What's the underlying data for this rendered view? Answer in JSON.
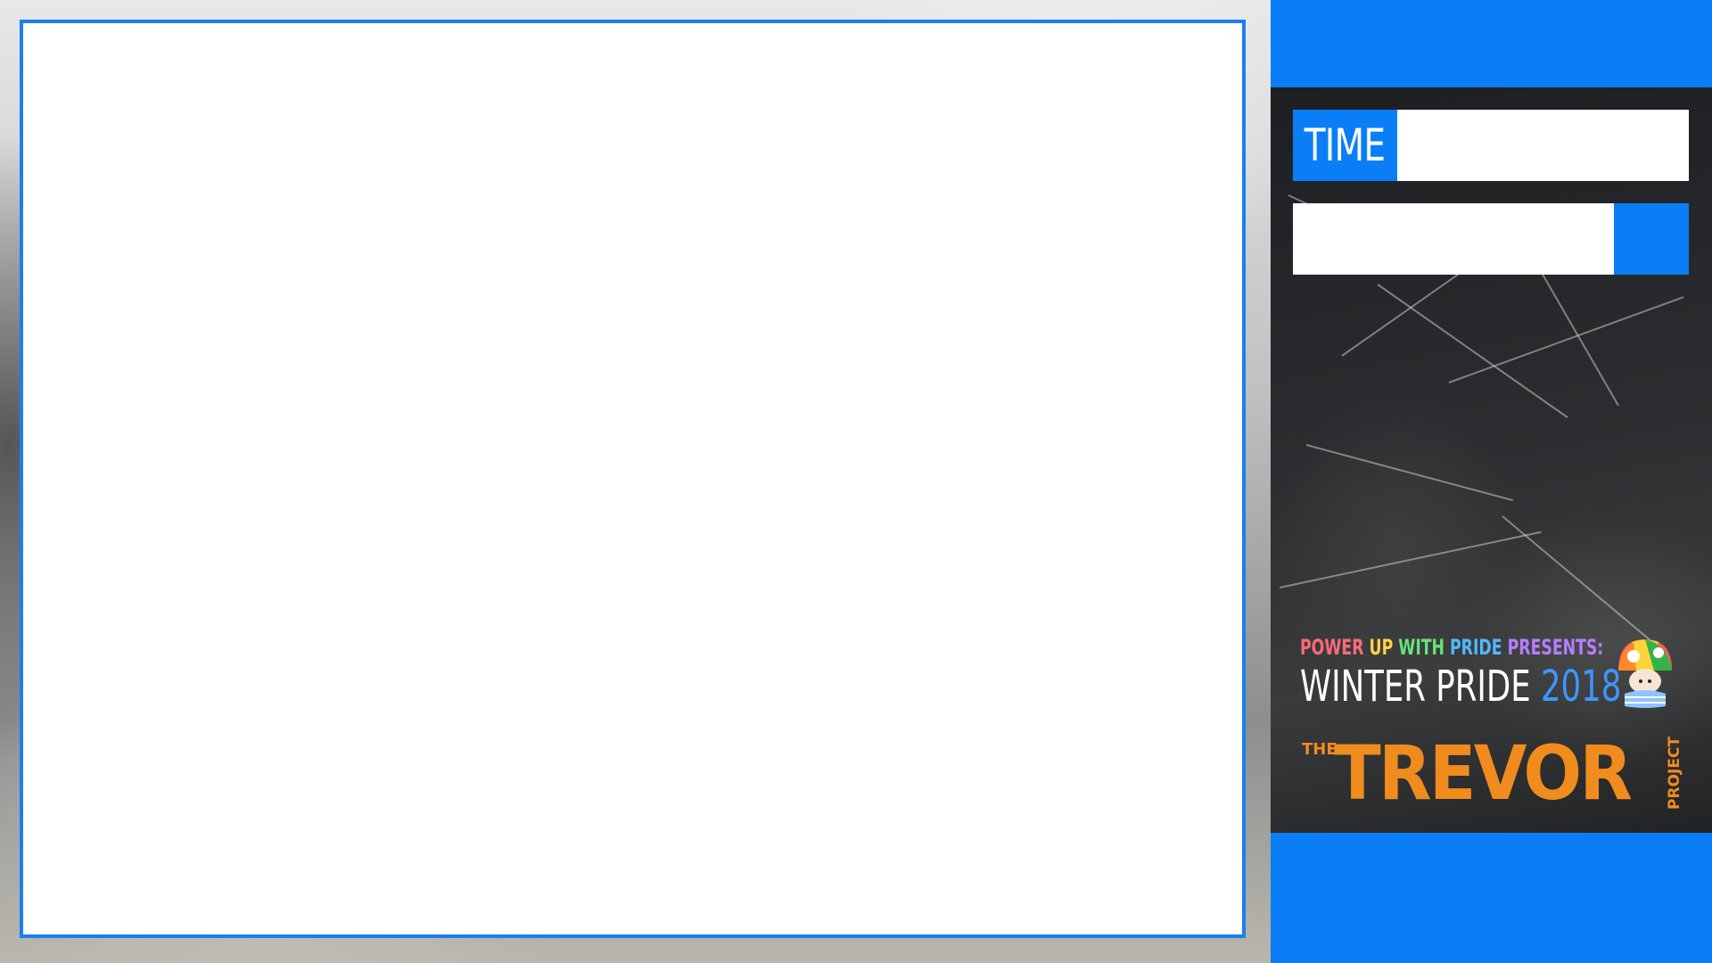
{
  "layout": {
    "accent_color": "#0a7ef6",
    "frame_border_color": "#1a7ff2"
  },
  "sidebar": {
    "time_label": "TIME",
    "time_value": "",
    "progress_fraction": 0.19
  },
  "logo": {
    "presents_words": [
      "POWER",
      "UP",
      "WITH",
      "PRIDE",
      "PRESENTS:"
    ],
    "event_title": "WINTER PRIDE",
    "event_year": "2018",
    "mascot_icon": "rainbow-mushroom-mascot-icon"
  },
  "sponsor": {
    "the": "THE",
    "name": "TREVOR",
    "project": "PROJECT",
    "color": "#f08c1e"
  }
}
